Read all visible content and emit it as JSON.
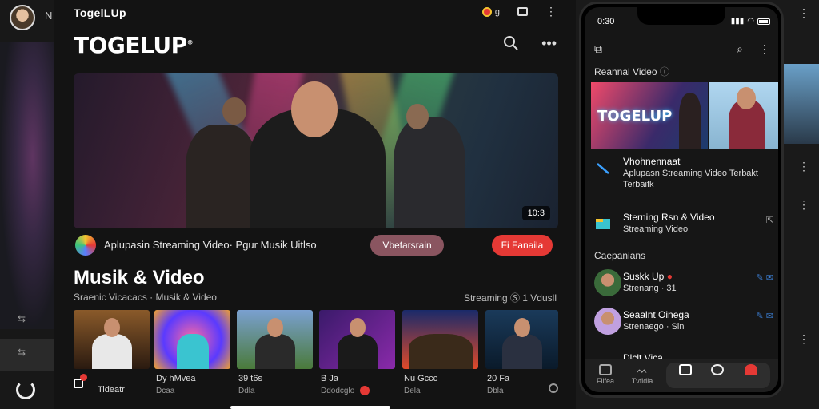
{
  "app": {
    "window_title": "TogelLUp",
    "logo": "TOGELUP",
    "logo_mark": "®"
  },
  "main": {
    "hero_badge": "10:3",
    "channel_text": "Aplupasin Streaming Video· Pgur Musik Uitlso",
    "subscribe_label": "Vbefarsrain",
    "follow_label": "Fi Fanaila",
    "section_title": "Musik & Video",
    "section_subtitle": "Sraenic Vicacacs · Musik & Video",
    "section_right": "Streaming Ⓢ 1 Vdusll",
    "thumbs": [
      {
        "label": "Tideatr",
        "sub": ""
      },
      {
        "label": "Dy hMvea",
        "sub": "Dcaa"
      },
      {
        "label": "39 t6s",
        "sub": "Ddla"
      },
      {
        "label": "B Ja",
        "sub": "Ddodcglo"
      },
      {
        "label": "Nu Gccc",
        "sub": "Dela"
      },
      {
        "label": "20 Fa",
        "sub": "Dbla"
      }
    ]
  },
  "phone": {
    "time": "0:30",
    "section1": "Reannal Video",
    "banner_logo": "TOGELUP",
    "row1_t1": "Vhohnennaat",
    "row1_t2": "Aplupasn Streaming Video Terbakt",
    "row1_t3": "Terbaifk",
    "row2_t1": "Sterning Rsn & Video",
    "row2_t2": "Streaming Video",
    "section2": "Caepanians",
    "row3_t1": "Suskk Up",
    "row3_t2": "Strenang · 31",
    "row4_t1": "Seaalnt Oinega",
    "row4_t2": "Strenaego · Sin",
    "row5_t1": "Dlclt Vica",
    "nav": [
      "Fiifea",
      "Tvfidla",
      "",
      "",
      ""
    ]
  },
  "colors": {
    "accent_red": "#e53935",
    "subscribe_pill": "#8a5560",
    "background": "#131313"
  }
}
